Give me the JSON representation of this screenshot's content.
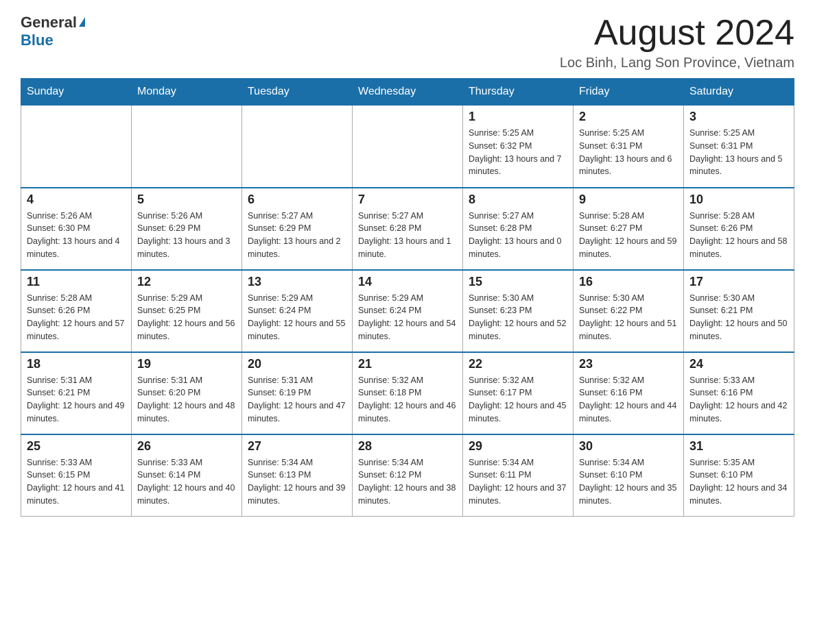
{
  "header": {
    "logo_general": "General",
    "logo_blue": "Blue",
    "month_year": "August 2024",
    "location": "Loc Binh, Lang Son Province, Vietnam"
  },
  "days_of_week": [
    "Sunday",
    "Monday",
    "Tuesday",
    "Wednesday",
    "Thursday",
    "Friday",
    "Saturday"
  ],
  "weeks": [
    [
      {
        "day": "",
        "info": ""
      },
      {
        "day": "",
        "info": ""
      },
      {
        "day": "",
        "info": ""
      },
      {
        "day": "",
        "info": ""
      },
      {
        "day": "1",
        "info": "Sunrise: 5:25 AM\nSunset: 6:32 PM\nDaylight: 13 hours and 7 minutes."
      },
      {
        "day": "2",
        "info": "Sunrise: 5:25 AM\nSunset: 6:31 PM\nDaylight: 13 hours and 6 minutes."
      },
      {
        "day": "3",
        "info": "Sunrise: 5:25 AM\nSunset: 6:31 PM\nDaylight: 13 hours and 5 minutes."
      }
    ],
    [
      {
        "day": "4",
        "info": "Sunrise: 5:26 AM\nSunset: 6:30 PM\nDaylight: 13 hours and 4 minutes."
      },
      {
        "day": "5",
        "info": "Sunrise: 5:26 AM\nSunset: 6:29 PM\nDaylight: 13 hours and 3 minutes."
      },
      {
        "day": "6",
        "info": "Sunrise: 5:27 AM\nSunset: 6:29 PM\nDaylight: 13 hours and 2 minutes."
      },
      {
        "day": "7",
        "info": "Sunrise: 5:27 AM\nSunset: 6:28 PM\nDaylight: 13 hours and 1 minute."
      },
      {
        "day": "8",
        "info": "Sunrise: 5:27 AM\nSunset: 6:28 PM\nDaylight: 13 hours and 0 minutes."
      },
      {
        "day": "9",
        "info": "Sunrise: 5:28 AM\nSunset: 6:27 PM\nDaylight: 12 hours and 59 minutes."
      },
      {
        "day": "10",
        "info": "Sunrise: 5:28 AM\nSunset: 6:26 PM\nDaylight: 12 hours and 58 minutes."
      }
    ],
    [
      {
        "day": "11",
        "info": "Sunrise: 5:28 AM\nSunset: 6:26 PM\nDaylight: 12 hours and 57 minutes."
      },
      {
        "day": "12",
        "info": "Sunrise: 5:29 AM\nSunset: 6:25 PM\nDaylight: 12 hours and 56 minutes."
      },
      {
        "day": "13",
        "info": "Sunrise: 5:29 AM\nSunset: 6:24 PM\nDaylight: 12 hours and 55 minutes."
      },
      {
        "day": "14",
        "info": "Sunrise: 5:29 AM\nSunset: 6:24 PM\nDaylight: 12 hours and 54 minutes."
      },
      {
        "day": "15",
        "info": "Sunrise: 5:30 AM\nSunset: 6:23 PM\nDaylight: 12 hours and 52 minutes."
      },
      {
        "day": "16",
        "info": "Sunrise: 5:30 AM\nSunset: 6:22 PM\nDaylight: 12 hours and 51 minutes."
      },
      {
        "day": "17",
        "info": "Sunrise: 5:30 AM\nSunset: 6:21 PM\nDaylight: 12 hours and 50 minutes."
      }
    ],
    [
      {
        "day": "18",
        "info": "Sunrise: 5:31 AM\nSunset: 6:21 PM\nDaylight: 12 hours and 49 minutes."
      },
      {
        "day": "19",
        "info": "Sunrise: 5:31 AM\nSunset: 6:20 PM\nDaylight: 12 hours and 48 minutes."
      },
      {
        "day": "20",
        "info": "Sunrise: 5:31 AM\nSunset: 6:19 PM\nDaylight: 12 hours and 47 minutes."
      },
      {
        "day": "21",
        "info": "Sunrise: 5:32 AM\nSunset: 6:18 PM\nDaylight: 12 hours and 46 minutes."
      },
      {
        "day": "22",
        "info": "Sunrise: 5:32 AM\nSunset: 6:17 PM\nDaylight: 12 hours and 45 minutes."
      },
      {
        "day": "23",
        "info": "Sunrise: 5:32 AM\nSunset: 6:16 PM\nDaylight: 12 hours and 44 minutes."
      },
      {
        "day": "24",
        "info": "Sunrise: 5:33 AM\nSunset: 6:16 PM\nDaylight: 12 hours and 42 minutes."
      }
    ],
    [
      {
        "day": "25",
        "info": "Sunrise: 5:33 AM\nSunset: 6:15 PM\nDaylight: 12 hours and 41 minutes."
      },
      {
        "day": "26",
        "info": "Sunrise: 5:33 AM\nSunset: 6:14 PM\nDaylight: 12 hours and 40 minutes."
      },
      {
        "day": "27",
        "info": "Sunrise: 5:34 AM\nSunset: 6:13 PM\nDaylight: 12 hours and 39 minutes."
      },
      {
        "day": "28",
        "info": "Sunrise: 5:34 AM\nSunset: 6:12 PM\nDaylight: 12 hours and 38 minutes."
      },
      {
        "day": "29",
        "info": "Sunrise: 5:34 AM\nSunset: 6:11 PM\nDaylight: 12 hours and 37 minutes."
      },
      {
        "day": "30",
        "info": "Sunrise: 5:34 AM\nSunset: 6:10 PM\nDaylight: 12 hours and 35 minutes."
      },
      {
        "day": "31",
        "info": "Sunrise: 5:35 AM\nSunset: 6:10 PM\nDaylight: 12 hours and 34 minutes."
      }
    ]
  ]
}
